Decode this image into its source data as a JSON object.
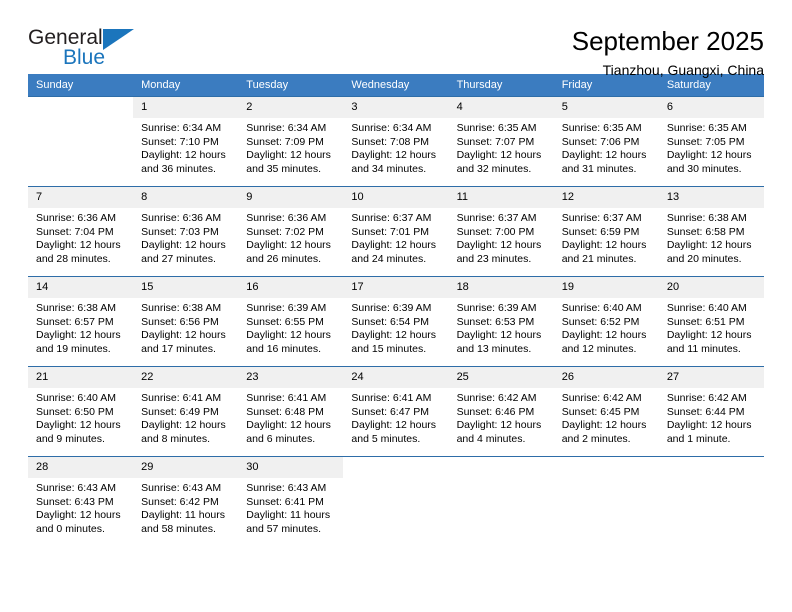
{
  "brand": {
    "name_part1": "General",
    "name_part2": "Blue"
  },
  "header": {
    "title": "September 2025",
    "subtitle": "Tianzhou, Guangxi, China"
  },
  "colors": {
    "header_blue": "#3b7cc0",
    "row_divider": "#2e6da8",
    "daynum_band": "#f0f0f0",
    "brand_blue": "#1b75bc"
  },
  "weekday_headers": [
    "Sunday",
    "Monday",
    "Tuesday",
    "Wednesday",
    "Thursday",
    "Friday",
    "Saturday"
  ],
  "weeks": [
    [
      {
        "day": "",
        "empty": true,
        "sunrise": "",
        "sunset": "",
        "daylight1": "",
        "daylight2": ""
      },
      {
        "day": "1",
        "empty": false,
        "sunrise": "Sunrise: 6:34 AM",
        "sunset": "Sunset: 7:10 PM",
        "daylight1": "Daylight: 12 hours",
        "daylight2": "and 36 minutes."
      },
      {
        "day": "2",
        "empty": false,
        "sunrise": "Sunrise: 6:34 AM",
        "sunset": "Sunset: 7:09 PM",
        "daylight1": "Daylight: 12 hours",
        "daylight2": "and 35 minutes."
      },
      {
        "day": "3",
        "empty": false,
        "sunrise": "Sunrise: 6:34 AM",
        "sunset": "Sunset: 7:08 PM",
        "daylight1": "Daylight: 12 hours",
        "daylight2": "and 34 minutes."
      },
      {
        "day": "4",
        "empty": false,
        "sunrise": "Sunrise: 6:35 AM",
        "sunset": "Sunset: 7:07 PM",
        "daylight1": "Daylight: 12 hours",
        "daylight2": "and 32 minutes."
      },
      {
        "day": "5",
        "empty": false,
        "sunrise": "Sunrise: 6:35 AM",
        "sunset": "Sunset: 7:06 PM",
        "daylight1": "Daylight: 12 hours",
        "daylight2": "and 31 minutes."
      },
      {
        "day": "6",
        "empty": false,
        "sunrise": "Sunrise: 6:35 AM",
        "sunset": "Sunset: 7:05 PM",
        "daylight1": "Daylight: 12 hours",
        "daylight2": "and 30 minutes."
      }
    ],
    [
      {
        "day": "7",
        "empty": false,
        "sunrise": "Sunrise: 6:36 AM",
        "sunset": "Sunset: 7:04 PM",
        "daylight1": "Daylight: 12 hours",
        "daylight2": "and 28 minutes."
      },
      {
        "day": "8",
        "empty": false,
        "sunrise": "Sunrise: 6:36 AM",
        "sunset": "Sunset: 7:03 PM",
        "daylight1": "Daylight: 12 hours",
        "daylight2": "and 27 minutes."
      },
      {
        "day": "9",
        "empty": false,
        "sunrise": "Sunrise: 6:36 AM",
        "sunset": "Sunset: 7:02 PM",
        "daylight1": "Daylight: 12 hours",
        "daylight2": "and 26 minutes."
      },
      {
        "day": "10",
        "empty": false,
        "sunrise": "Sunrise: 6:37 AM",
        "sunset": "Sunset: 7:01 PM",
        "daylight1": "Daylight: 12 hours",
        "daylight2": "and 24 minutes."
      },
      {
        "day": "11",
        "empty": false,
        "sunrise": "Sunrise: 6:37 AM",
        "sunset": "Sunset: 7:00 PM",
        "daylight1": "Daylight: 12 hours",
        "daylight2": "and 23 minutes."
      },
      {
        "day": "12",
        "empty": false,
        "sunrise": "Sunrise: 6:37 AM",
        "sunset": "Sunset: 6:59 PM",
        "daylight1": "Daylight: 12 hours",
        "daylight2": "and 21 minutes."
      },
      {
        "day": "13",
        "empty": false,
        "sunrise": "Sunrise: 6:38 AM",
        "sunset": "Sunset: 6:58 PM",
        "daylight1": "Daylight: 12 hours",
        "daylight2": "and 20 minutes."
      }
    ],
    [
      {
        "day": "14",
        "empty": false,
        "sunrise": "Sunrise: 6:38 AM",
        "sunset": "Sunset: 6:57 PM",
        "daylight1": "Daylight: 12 hours",
        "daylight2": "and 19 minutes."
      },
      {
        "day": "15",
        "empty": false,
        "sunrise": "Sunrise: 6:38 AM",
        "sunset": "Sunset: 6:56 PM",
        "daylight1": "Daylight: 12 hours",
        "daylight2": "and 17 minutes."
      },
      {
        "day": "16",
        "empty": false,
        "sunrise": "Sunrise: 6:39 AM",
        "sunset": "Sunset: 6:55 PM",
        "daylight1": "Daylight: 12 hours",
        "daylight2": "and 16 minutes."
      },
      {
        "day": "17",
        "empty": false,
        "sunrise": "Sunrise: 6:39 AM",
        "sunset": "Sunset: 6:54 PM",
        "daylight1": "Daylight: 12 hours",
        "daylight2": "and 15 minutes."
      },
      {
        "day": "18",
        "empty": false,
        "sunrise": "Sunrise: 6:39 AM",
        "sunset": "Sunset: 6:53 PM",
        "daylight1": "Daylight: 12 hours",
        "daylight2": "and 13 minutes."
      },
      {
        "day": "19",
        "empty": false,
        "sunrise": "Sunrise: 6:40 AM",
        "sunset": "Sunset: 6:52 PM",
        "daylight1": "Daylight: 12 hours",
        "daylight2": "and 12 minutes."
      },
      {
        "day": "20",
        "empty": false,
        "sunrise": "Sunrise: 6:40 AM",
        "sunset": "Sunset: 6:51 PM",
        "daylight1": "Daylight: 12 hours",
        "daylight2": "and 11 minutes."
      }
    ],
    [
      {
        "day": "21",
        "empty": false,
        "sunrise": "Sunrise: 6:40 AM",
        "sunset": "Sunset: 6:50 PM",
        "daylight1": "Daylight: 12 hours",
        "daylight2": "and 9 minutes."
      },
      {
        "day": "22",
        "empty": false,
        "sunrise": "Sunrise: 6:41 AM",
        "sunset": "Sunset: 6:49 PM",
        "daylight1": "Daylight: 12 hours",
        "daylight2": "and 8 minutes."
      },
      {
        "day": "23",
        "empty": false,
        "sunrise": "Sunrise: 6:41 AM",
        "sunset": "Sunset: 6:48 PM",
        "daylight1": "Daylight: 12 hours",
        "daylight2": "and 6 minutes."
      },
      {
        "day": "24",
        "empty": false,
        "sunrise": "Sunrise: 6:41 AM",
        "sunset": "Sunset: 6:47 PM",
        "daylight1": "Daylight: 12 hours",
        "daylight2": "and 5 minutes."
      },
      {
        "day": "25",
        "empty": false,
        "sunrise": "Sunrise: 6:42 AM",
        "sunset": "Sunset: 6:46 PM",
        "daylight1": "Daylight: 12 hours",
        "daylight2": "and 4 minutes."
      },
      {
        "day": "26",
        "empty": false,
        "sunrise": "Sunrise: 6:42 AM",
        "sunset": "Sunset: 6:45 PM",
        "daylight1": "Daylight: 12 hours",
        "daylight2": "and 2 minutes."
      },
      {
        "day": "27",
        "empty": false,
        "sunrise": "Sunrise: 6:42 AM",
        "sunset": "Sunset: 6:44 PM",
        "daylight1": "Daylight: 12 hours",
        "daylight2": "and 1 minute."
      }
    ],
    [
      {
        "day": "28",
        "empty": false,
        "sunrise": "Sunrise: 6:43 AM",
        "sunset": "Sunset: 6:43 PM",
        "daylight1": "Daylight: 12 hours",
        "daylight2": "and 0 minutes."
      },
      {
        "day": "29",
        "empty": false,
        "sunrise": "Sunrise: 6:43 AM",
        "sunset": "Sunset: 6:42 PM",
        "daylight1": "Daylight: 11 hours",
        "daylight2": "and 58 minutes."
      },
      {
        "day": "30",
        "empty": false,
        "sunrise": "Sunrise: 6:43 AM",
        "sunset": "Sunset: 6:41 PM",
        "daylight1": "Daylight: 11 hours",
        "daylight2": "and 57 minutes."
      },
      {
        "day": "",
        "empty": true,
        "sunrise": "",
        "sunset": "",
        "daylight1": "",
        "daylight2": ""
      },
      {
        "day": "",
        "empty": true,
        "sunrise": "",
        "sunset": "",
        "daylight1": "",
        "daylight2": ""
      },
      {
        "day": "",
        "empty": true,
        "sunrise": "",
        "sunset": "",
        "daylight1": "",
        "daylight2": ""
      },
      {
        "day": "",
        "empty": true,
        "sunrise": "",
        "sunset": "",
        "daylight1": "",
        "daylight2": ""
      }
    ]
  ]
}
